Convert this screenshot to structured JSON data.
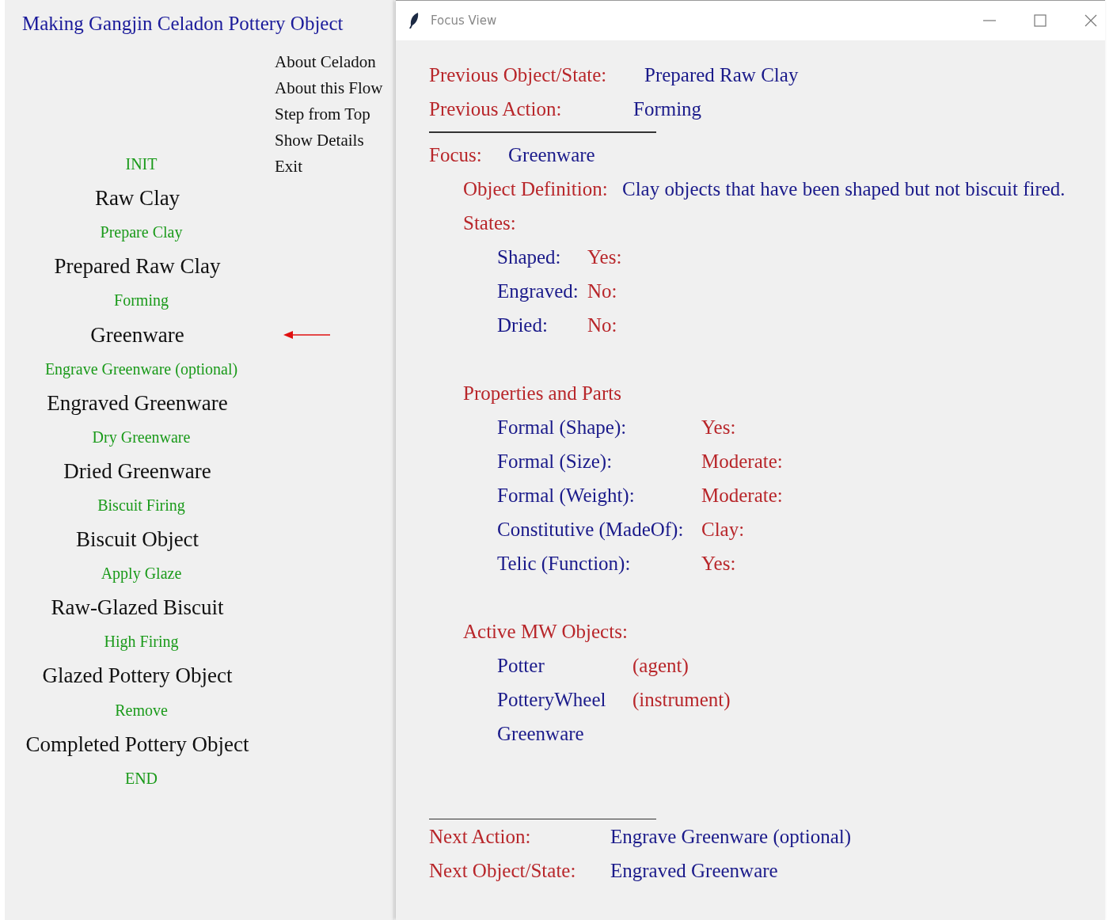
{
  "main": {
    "title": "Making Gangjin Celadon Pottery Object",
    "menu": [
      "About Celadon",
      "About this Flow",
      "Step from Top",
      "Show Details",
      "Exit"
    ],
    "flow": [
      {
        "kind": "terminal",
        "label": "INIT",
        "current": false
      },
      {
        "kind": "state",
        "label": "Raw Clay",
        "current": false
      },
      {
        "kind": "action",
        "label": "Prepare Clay",
        "current": false
      },
      {
        "kind": "state",
        "label": "Prepared Raw Clay",
        "current": false
      },
      {
        "kind": "action",
        "label": "Forming",
        "current": false
      },
      {
        "kind": "state",
        "label": "Greenware",
        "current": true
      },
      {
        "kind": "action",
        "label": "Engrave Greenware (optional)",
        "current": false
      },
      {
        "kind": "state",
        "label": "Engraved Greenware",
        "current": false
      },
      {
        "kind": "action",
        "label": "Dry Greenware",
        "current": false
      },
      {
        "kind": "state",
        "label": "Dried Greenware",
        "current": false
      },
      {
        "kind": "action",
        "label": "Biscuit Firing",
        "current": false
      },
      {
        "kind": "state",
        "label": "Biscuit Object",
        "current": false
      },
      {
        "kind": "action",
        "label": "Apply Glaze",
        "current": false
      },
      {
        "kind": "state",
        "label": "Raw-Glazed Biscuit",
        "current": false
      },
      {
        "kind": "action",
        "label": "High Firing",
        "current": false
      },
      {
        "kind": "state",
        "label": "Glazed Pottery Object",
        "current": false
      },
      {
        "kind": "action",
        "label": "Remove",
        "current": false
      },
      {
        "kind": "state",
        "label": "Completed Pottery Object",
        "current": false
      },
      {
        "kind": "terminal",
        "label": "END",
        "current": false
      }
    ]
  },
  "focus_window": {
    "title": "Focus View",
    "previous": {
      "object_label": "Previous Object/State:",
      "object_value": "Prepared Raw Clay",
      "action_label": "Previous Action:",
      "action_value": "Forming"
    },
    "focus": {
      "label": "Focus:",
      "value": "Greenware"
    },
    "definition": {
      "label": "Object Definition:",
      "value": "Clay objects that have been shaped but not biscuit fired."
    },
    "states": {
      "label": "States:",
      "items": [
        {
          "name": "Shaped:",
          "value": "Yes:"
        },
        {
          "name": "Engraved:",
          "value": "No:"
        },
        {
          "name": "Dried:",
          "value": "No:"
        }
      ]
    },
    "properties": {
      "label": "Properties and Parts",
      "items": [
        {
          "name": "Formal (Shape):",
          "value": "Yes:"
        },
        {
          "name": "Formal (Size):",
          "value": "Moderate:"
        },
        {
          "name": "Formal (Weight):",
          "value": "Moderate:"
        },
        {
          "name": "Constitutive (MadeOf):",
          "value": "Clay:"
        },
        {
          "name": "Telic (Function):",
          "value": "Yes:"
        }
      ]
    },
    "active_objects": {
      "label": "Active MW Objects:",
      "items": [
        {
          "name": "Potter",
          "role": "(agent)"
        },
        {
          "name": "PotteryWheel",
          "role": "(instrument)"
        },
        {
          "name": "Greenware"
        }
      ]
    },
    "next": {
      "action_label": "Next Action:",
      "action_value": "Engrave Greenware (optional)",
      "object_label": "Next Object/State:",
      "object_value": "Engraved Greenware"
    }
  }
}
